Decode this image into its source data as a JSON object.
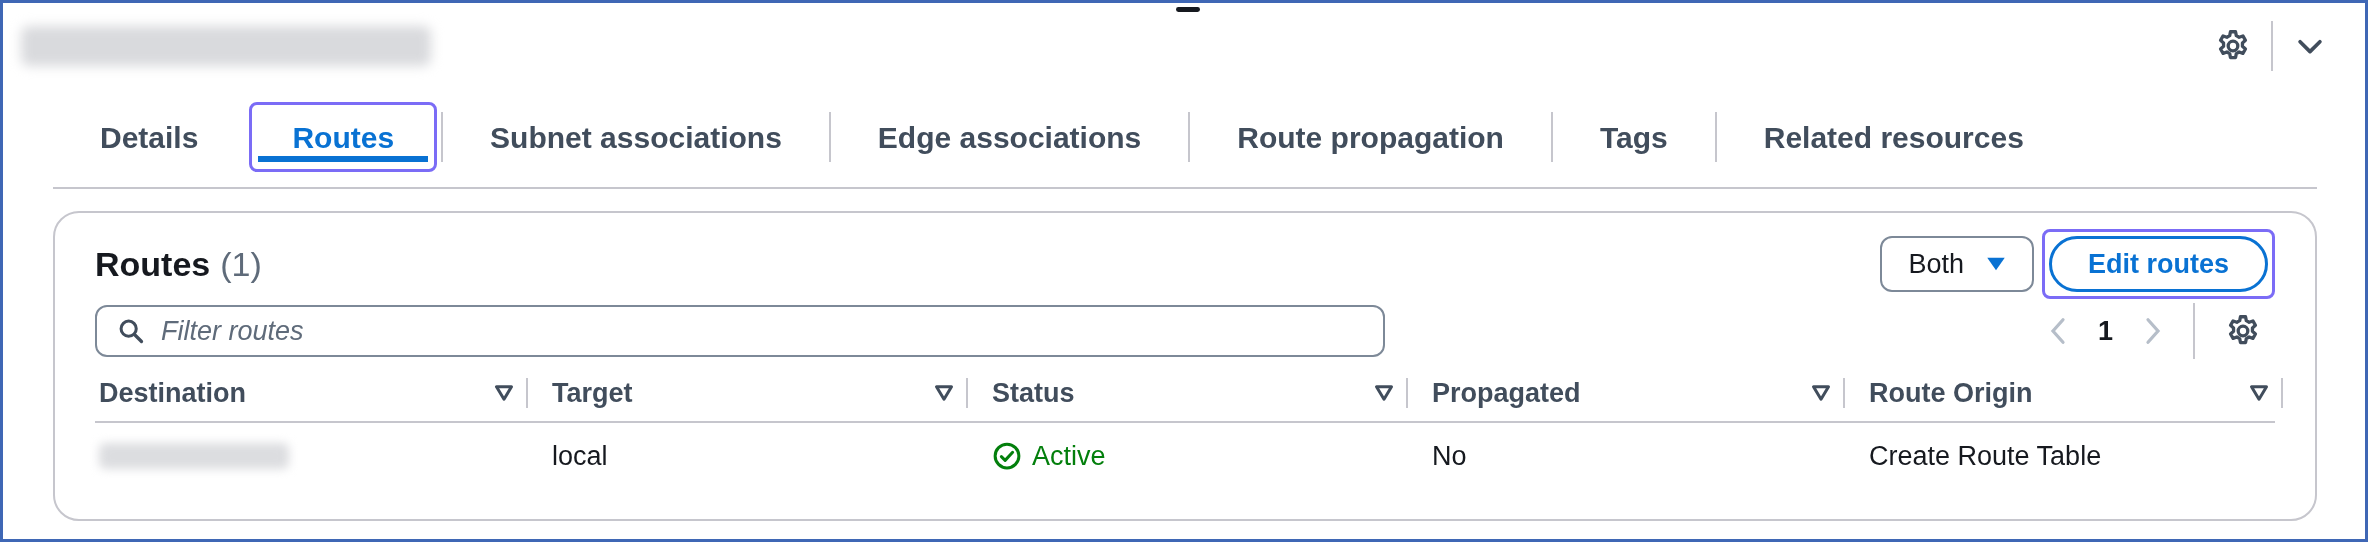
{
  "tabs": [
    {
      "label": "Details",
      "selected": false
    },
    {
      "label": "Routes",
      "selected": true
    },
    {
      "label": "Subnet associations",
      "selected": false
    },
    {
      "label": "Edge associations",
      "selected": false
    },
    {
      "label": "Route propagation",
      "selected": false
    },
    {
      "label": "Tags",
      "selected": false
    },
    {
      "label": "Related resources",
      "selected": false
    }
  ],
  "routes_panel": {
    "title": "Routes",
    "count": "(1)",
    "filter": {
      "placeholder": "Filter routes"
    },
    "propagation_filter": "Both",
    "edit_button": "Edit routes",
    "page": "1",
    "table": {
      "columns": [
        "Destination",
        "Target",
        "Status",
        "Propagated",
        "Route Origin"
      ],
      "rows": [
        {
          "destination_redacted": true,
          "target": "local",
          "status": {
            "label": "Active",
            "kind": "success"
          },
          "propagated": "No",
          "route_origin": "Create Route Table"
        }
      ]
    }
  }
}
